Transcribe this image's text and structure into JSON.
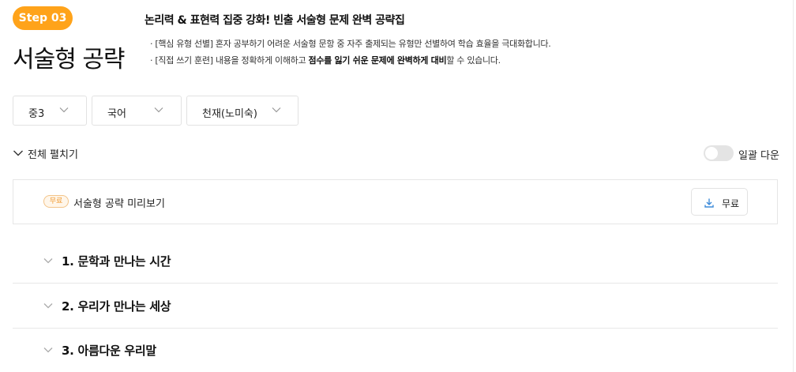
{
  "header": {
    "step_badge": "Step 03",
    "page_title": "서술형 공략",
    "headline": "논리력 & 표현력 집중 강화! 빈출 서술형 문제 완벽 공략집",
    "desc1": "· [핵심 유형 선별] 혼자 공부하기 어려운 서술형 문항 중 자주 출제되는 유형만 선별하여 학습 효율을 극대화합니다.",
    "desc2_pre": "· [직접 쓰기 훈련] 내용을 정확하게 이해하고 ",
    "desc2_bold": "점수를 잃기 쉬운 문제에 완벽하게 대비",
    "desc2_post": "할 수 있습니다."
  },
  "filters": {
    "grade": "중3",
    "subject": "국어",
    "publisher": "천재(노미숙)"
  },
  "controls": {
    "expand_all": "전체 펼치기",
    "bulk_download": "일괄 다운",
    "bulk_download_on": false
  },
  "preview": {
    "tag": "무료",
    "title": "서술형 공략 미리보기",
    "download_label": "무료"
  },
  "chapters": [
    {
      "title": "1. 문학과 만나는 시간"
    },
    {
      "title": "2. 우리가 만나는 세상"
    },
    {
      "title": "3. 아름다운 우리말"
    }
  ],
  "colors": {
    "accent": "#ffa31a",
    "download_icon": "#3d8bd9",
    "free_tag": "#f19b33"
  }
}
